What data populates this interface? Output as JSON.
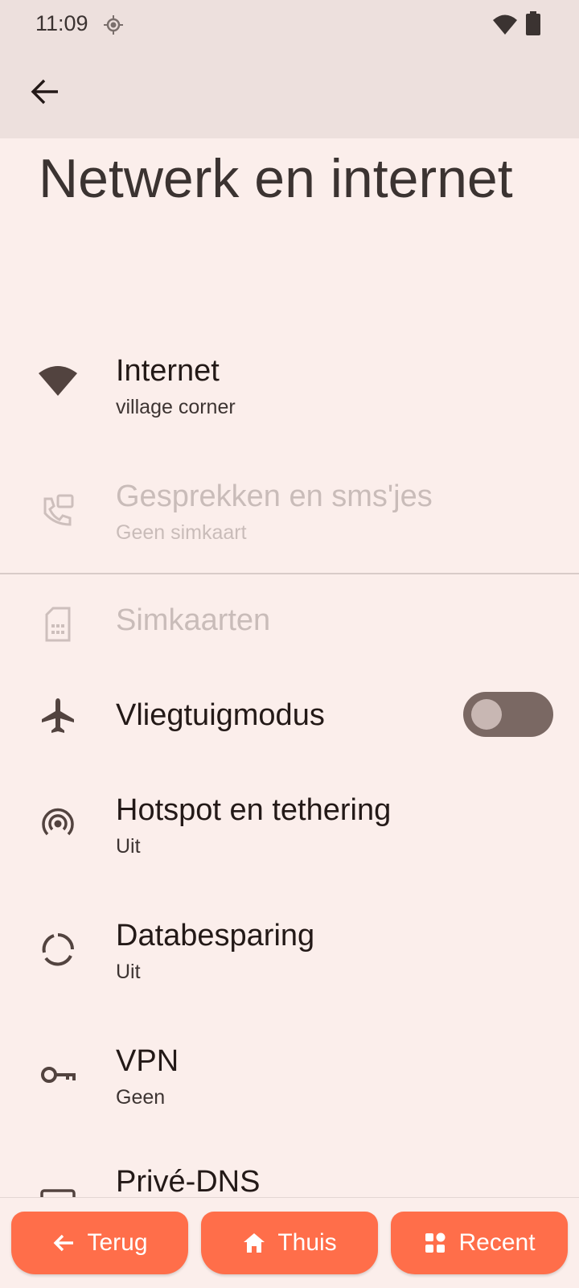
{
  "status_bar": {
    "time": "11:09"
  },
  "header": {
    "title": "Netwerk en internet"
  },
  "items": [
    {
      "title": "Internet",
      "subtitle": "village corner",
      "icon": "wifi-icon"
    },
    {
      "title": "Gesprekken en sms'jes",
      "subtitle": "Geen simkaart",
      "icon": "call-sms-icon"
    },
    {
      "title": "Simkaarten",
      "icon": "sim-card-icon"
    },
    {
      "title": "Vliegtuigmodus",
      "icon": "airplane-icon",
      "toggle_state": "off"
    },
    {
      "title": "Hotspot en tethering",
      "subtitle": "Uit",
      "icon": "hotspot-icon"
    },
    {
      "title": "Databesparing",
      "subtitle": "Uit",
      "icon": "data-saver-icon"
    },
    {
      "title": "VPN",
      "subtitle": "Geen",
      "icon": "vpn-key-icon"
    },
    {
      "title": "Privé-DNS",
      "icon": "dns-icon"
    }
  ],
  "nav": {
    "back_label": "Terug",
    "home_label": "Thuis",
    "recent_label": "Recent"
  },
  "colors": {
    "background": "#FBEEEB",
    "app_bar": "#EDE0DD",
    "nav_button": "#FF6E4A",
    "toggle_track": "#7a6863"
  }
}
